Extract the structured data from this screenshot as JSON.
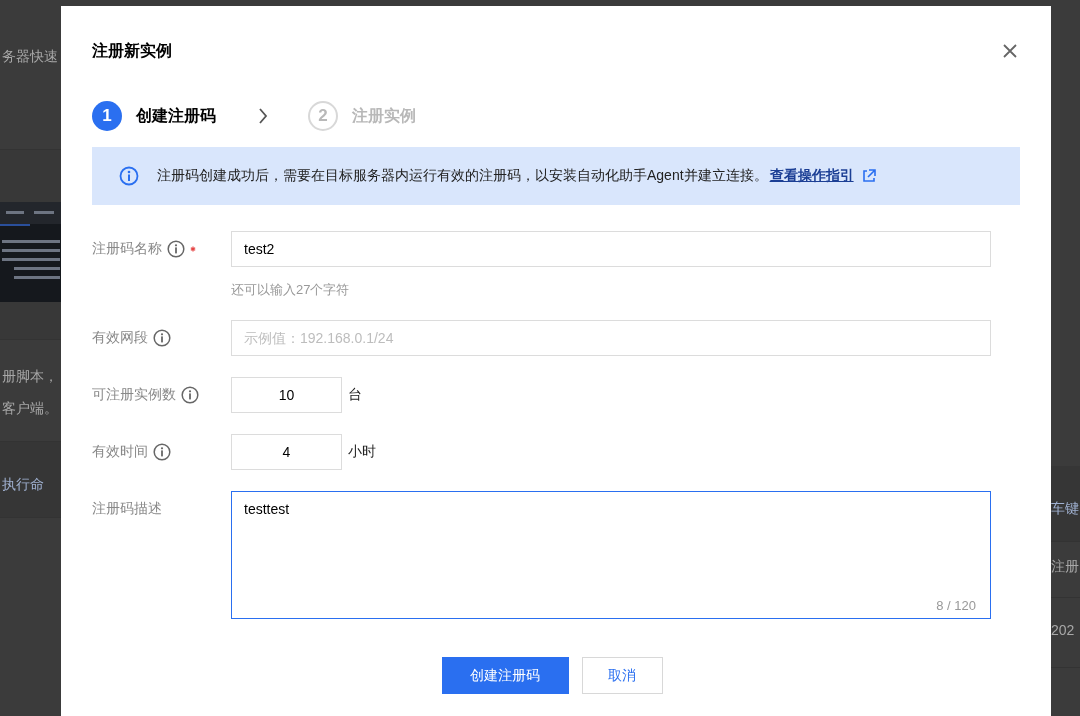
{
  "background_page": {
    "left": [
      {
        "kind": "text",
        "text": "务器快速"
      },
      {
        "kind": "code"
      },
      {
        "kind": "text",
        "text": "册脚本，"
      },
      {
        "kind": "text",
        "text": "客户端。"
      },
      {
        "kind": "tab",
        "text": "执行命"
      }
    ],
    "right": [
      {
        "kind": "tab",
        "text": "车键"
      },
      {
        "kind": "text",
        "text": "注册"
      },
      {
        "kind": "text",
        "text": "202"
      }
    ]
  },
  "dialog": {
    "title": "注册新实例",
    "steps": [
      {
        "number": "1",
        "label": "创建注册码",
        "selected": true
      },
      {
        "number": "2",
        "label": "注册实例",
        "selected": false
      }
    ],
    "notice": {
      "text": "注册码创建成功后，需要在目标服务器内运行有效的注册码，以安装自动化助手Agent并建立连接。",
      "link": "查看操作指引"
    },
    "fields": [
      {
        "kind": "text",
        "label": "注册码名称",
        "info": true,
        "required": true,
        "value": "test2",
        "hint": "还可以输入27个字符"
      },
      {
        "kind": "text",
        "label": "有效网段",
        "info": true,
        "required": false,
        "placeholder": "示例值：192.168.0.1/24"
      },
      {
        "kind": "number",
        "label": "可注册实例数",
        "info": true,
        "required": false,
        "value": "10",
        "unit": "台"
      },
      {
        "kind": "number",
        "label": "有效时间",
        "info": true,
        "required": false,
        "value": "4",
        "unit": "小时"
      },
      {
        "kind": "textarea",
        "label": "注册码描述",
        "info": false,
        "required": false,
        "value": "testtest",
        "counter": "8 / 120"
      }
    ],
    "buttons": [
      {
        "label": "创建注册码",
        "kind": "primary"
      },
      {
        "label": "取消",
        "kind": "secondary"
      }
    ]
  }
}
